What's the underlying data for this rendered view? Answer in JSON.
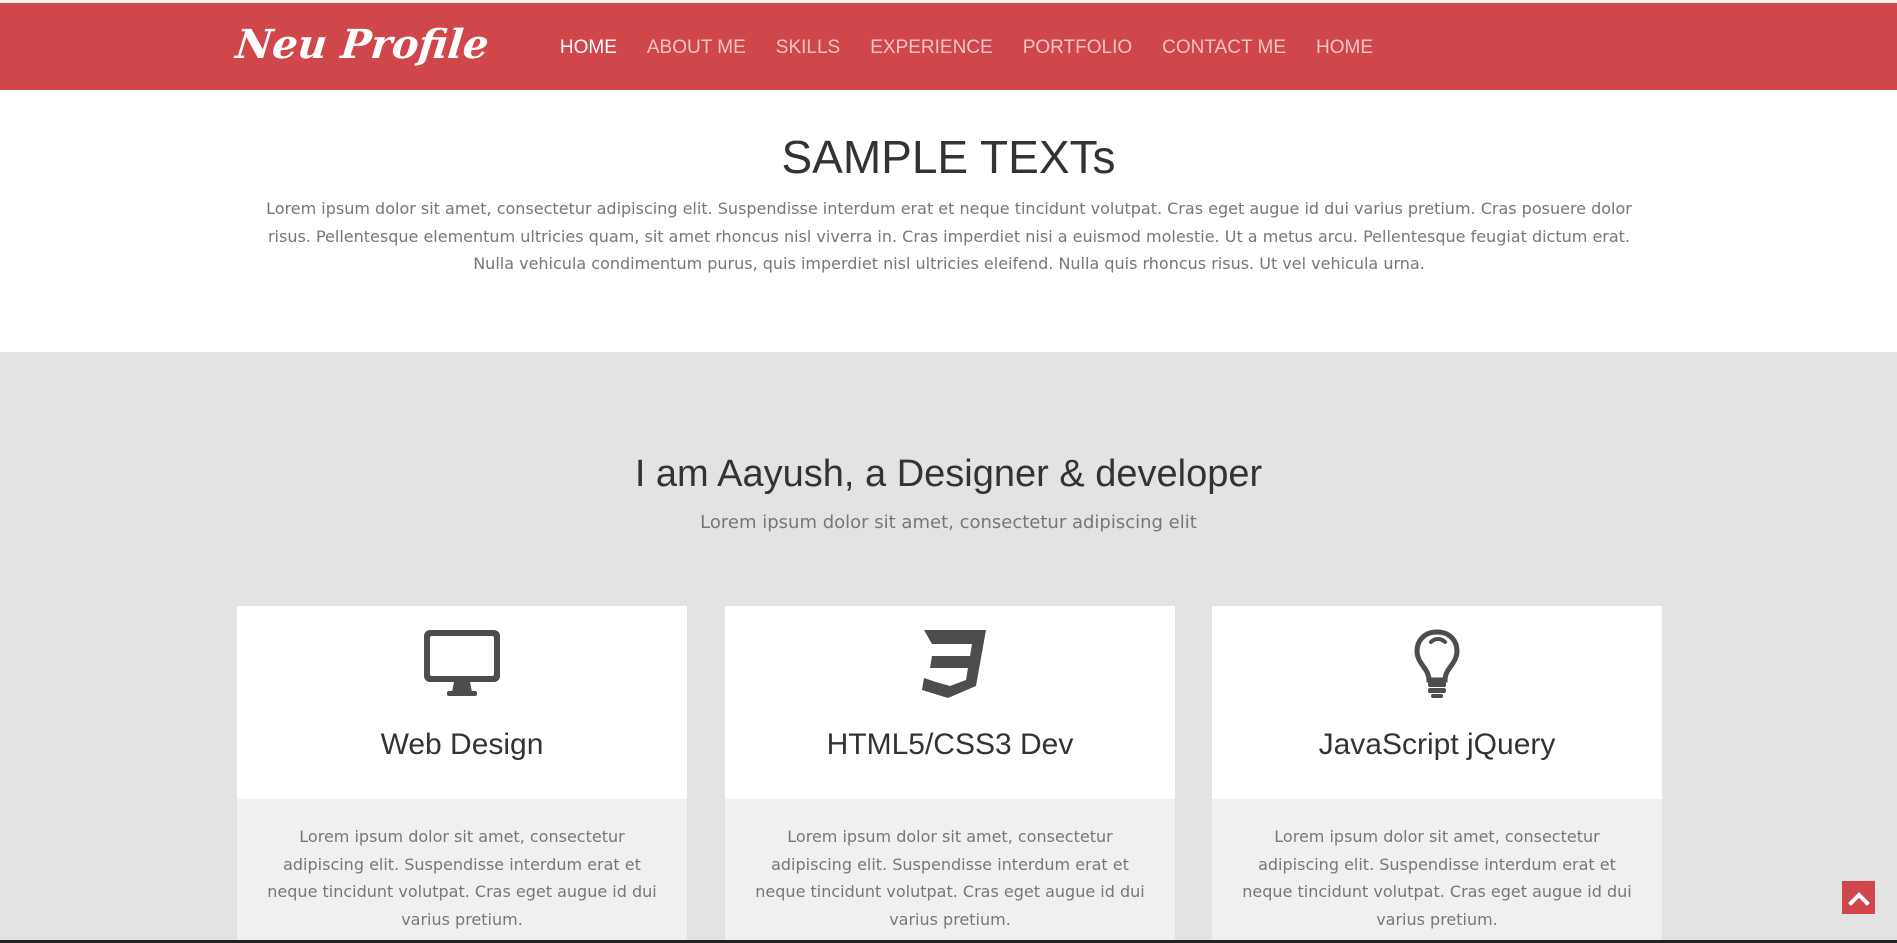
{
  "header": {
    "brand": "Neu Profile",
    "nav": [
      "HOME",
      "ABOUT ME",
      "SKILLS",
      "EXPERIENCE",
      "PORTFOLIO",
      "CONTACT ME",
      "HOME"
    ],
    "active_index": 0,
    "background": "#cf464b"
  },
  "intro": {
    "title": "SAMPLE TEXTs",
    "body": "Lorem ipsum dolor sit amet, consectetur adipiscing elit. Suspendisse interdum erat et neque tincidunt volutpat. Cras eget augue id dui varius pretium. Cras posuere dolor risus. Pellentesque elementum ultricies quam, sit amet rhoncus nisl viverra in. Cras imperdiet nisi a euismod molestie. Ut a metus arcu. Pellentesque feugiat dictum erat. Nulla vehicula condimentum purus, quis imperdiet nisl ultricies eleifend. Nulla quis rhoncus risus. Ut vel vehicula urna."
  },
  "services": {
    "heading": "I am Aayush, a Designer & developer",
    "subheading": "Lorem ipsum dolor sit amet, consectetur adipiscing elit",
    "cards": [
      {
        "icon": "desktop-icon",
        "title": "Web Design",
        "text": "Lorem ipsum dolor sit amet, consectetur adipiscing elit. Suspendisse interdum erat et neque tincidunt volutpat. Cras eget augue id dui varius pretium."
      },
      {
        "icon": "css3-icon",
        "title": "HTML5/CSS3 Dev",
        "text": "Lorem ipsum dolor sit amet, consectetur adipiscing elit. Suspendisse interdum erat et neque tincidunt volutpat. Cras eget augue id dui varius pretium."
      },
      {
        "icon": "lightbulb-icon",
        "title": "JavaScript jQuery",
        "text": "Lorem ipsum dolor sit amet, consectetur adipiscing elit. Suspendisse interdum erat et neque tincidunt volutpat. Cras eget augue id dui varius pretium."
      }
    ]
  },
  "back_to_top": {
    "icon": "chevron-up-icon"
  }
}
